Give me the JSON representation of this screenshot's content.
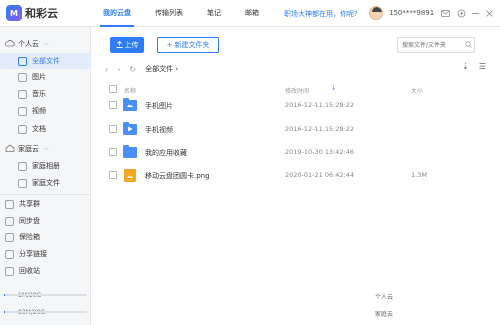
{
  "app": {
    "logo_text": "和彩云",
    "logo_mark": "M"
  },
  "nav": {
    "items": [
      {
        "label": "我的云盘",
        "active": true
      },
      {
        "label": "传输列表",
        "active": false
      },
      {
        "label": "笔记",
        "active": false
      },
      {
        "label": "邮箱",
        "active": false
      }
    ]
  },
  "promo": "职场大神都在用，你呢?",
  "user": {
    "name": "150****9891"
  },
  "sidebar": {
    "personal_cloud": "个人云",
    "personal_items": [
      {
        "label": "全部文件",
        "active": true,
        "icon": "all-files-icon"
      },
      {
        "label": "图片",
        "icon": "image-icon"
      },
      {
        "label": "音乐",
        "icon": "music-icon"
      },
      {
        "label": "视频",
        "icon": "video-icon"
      },
      {
        "label": "文档",
        "icon": "document-icon"
      }
    ],
    "family_cloud": "家庭云",
    "family_items": [
      {
        "label": "家庭相册",
        "icon": "family-album-icon"
      },
      {
        "label": "家庭文件",
        "icon": "family-files-icon"
      }
    ],
    "other_items": [
      {
        "label": "共享群",
        "icon": "share-group-icon"
      },
      {
        "label": "同步盘",
        "icon": "sync-disk-icon"
      },
      {
        "label": "保险箱",
        "icon": "safe-icon"
      },
      {
        "label": "分享链接",
        "icon": "share-link-icon"
      },
      {
        "label": "回收站",
        "icon": "recycle-bin-icon"
      }
    ],
    "storage": [
      {
        "used": "1M/20G",
        "label": "个人云",
        "fraction": 0.0
      },
      {
        "used": "83M/20G",
        "label": "家庭云",
        "fraction": 0.004
      }
    ]
  },
  "toolbar": {
    "upload_label": "上传",
    "new_folder_label": "新建文件夹",
    "search_placeholder": "搜索文件/文件夹"
  },
  "breadcrumb": {
    "current": "全部文件"
  },
  "table": {
    "headers": {
      "name": "名称",
      "time": "修改时间",
      "size": "大小"
    },
    "rows": [
      {
        "name": "手机图片",
        "time": "2016-12-11 15:28:22",
        "size": "",
        "type": "folder-image"
      },
      {
        "name": "手机视频",
        "time": "2016-12-11 15:28:22",
        "size": "",
        "type": "folder-video"
      },
      {
        "name": "我的应用收藏",
        "time": "2019-10-30 13:42:46",
        "size": "",
        "type": "folder"
      },
      {
        "name": "移动云盘团圆卡.png",
        "time": "2020-01-21 06:42:44",
        "size": "1.3M",
        "type": "image"
      }
    ]
  },
  "colors": {
    "accent": "#2e7cf6",
    "folder": "#4a8ff7",
    "image_file": "#f5a623"
  }
}
